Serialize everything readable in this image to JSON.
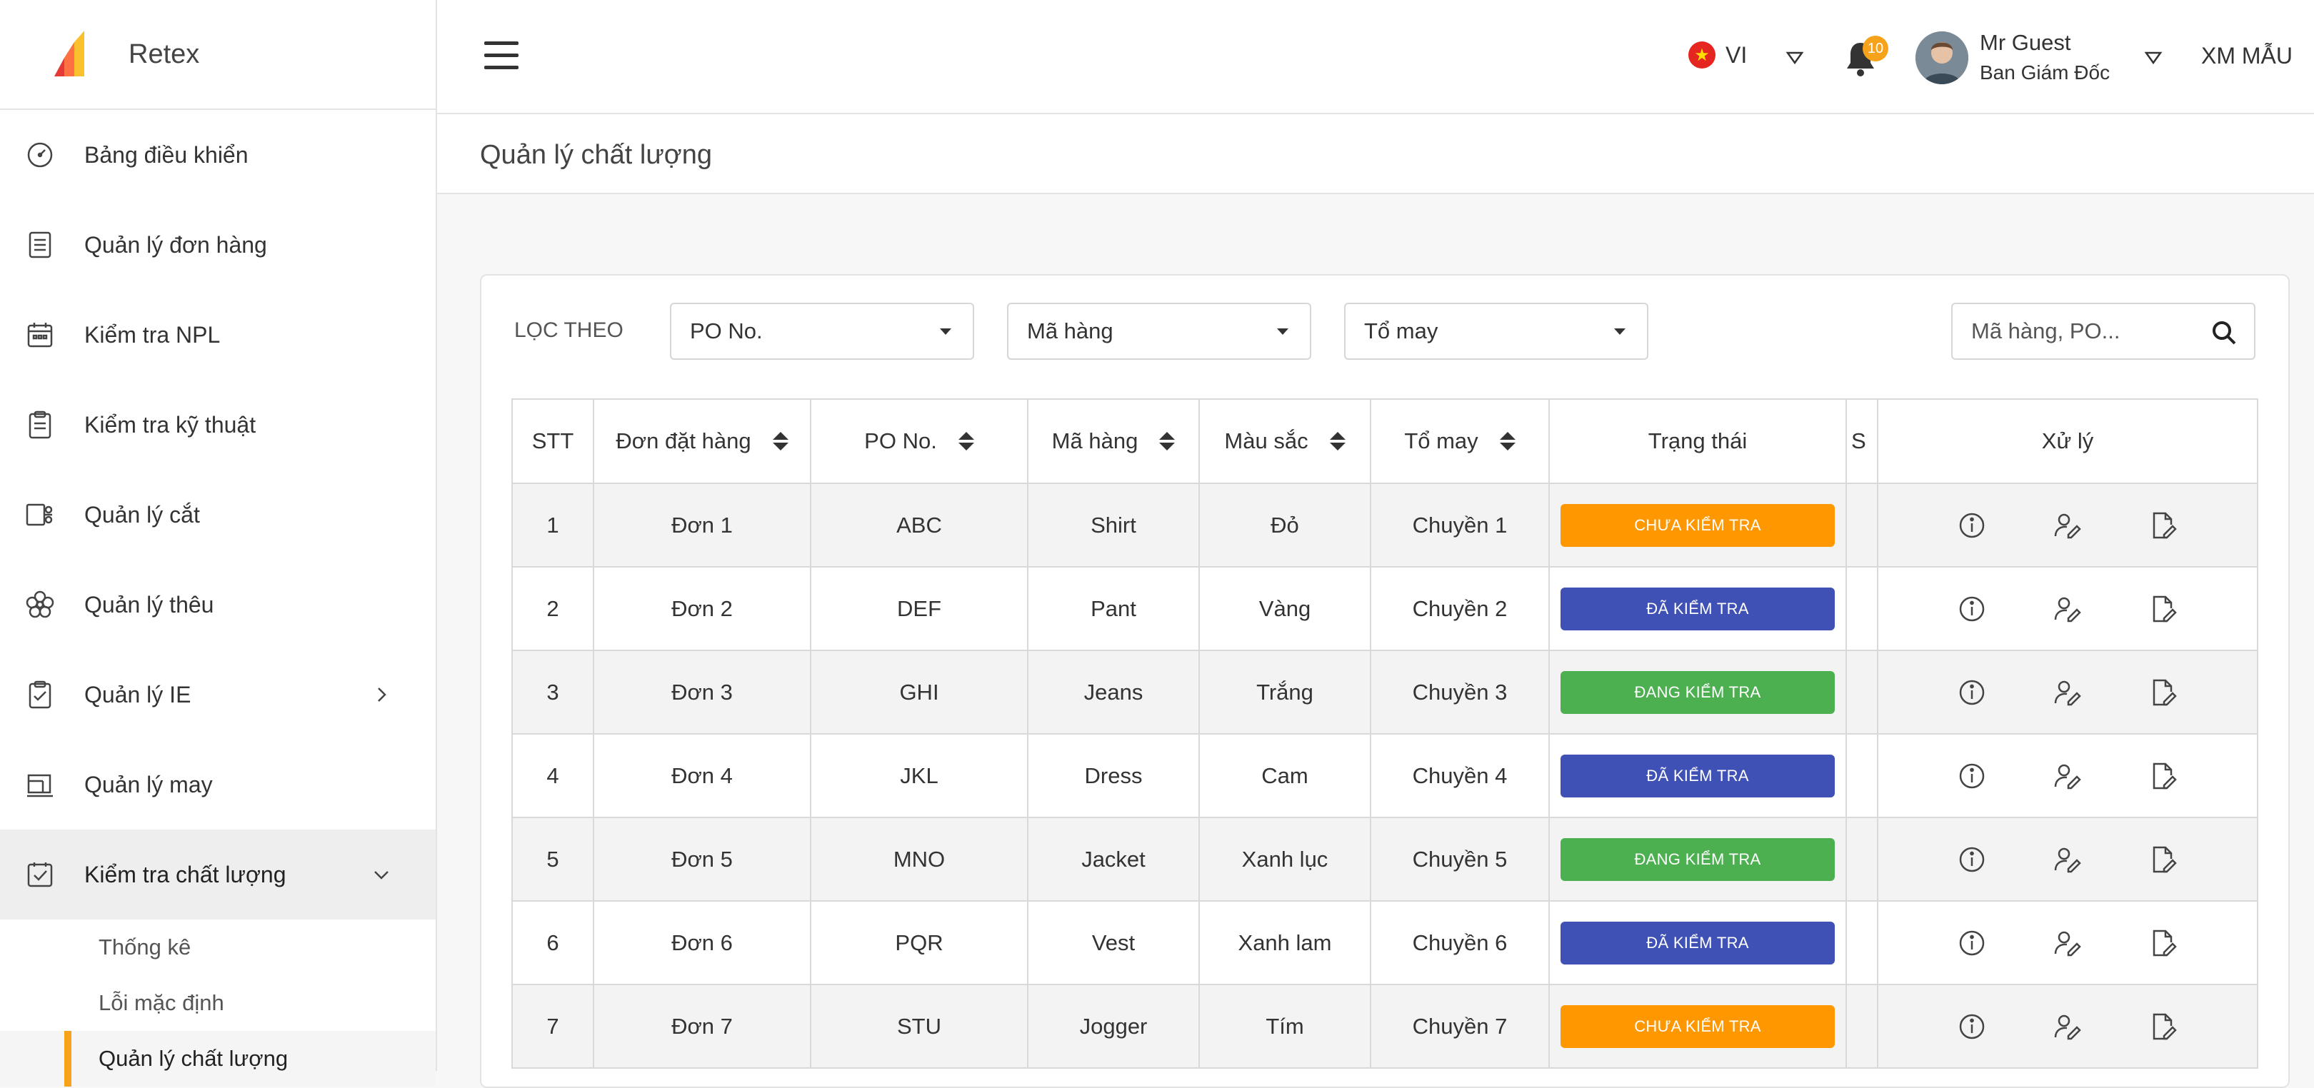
{
  "app": {
    "name": "Retex"
  },
  "sidebar": {
    "items": [
      {
        "label": "Bảng điều khiển",
        "icon": "dashboard-icon"
      },
      {
        "label": "Quản lý đơn hàng",
        "icon": "document-list-icon"
      },
      {
        "label": "Kiểm tra NPL",
        "icon": "calendar-icon"
      },
      {
        "label": "Kiểm tra kỹ thuật",
        "icon": "clipboard-icon"
      },
      {
        "label": "Quản lý cắt",
        "icon": "scissors-icon"
      },
      {
        "label": "Quản lý thêu",
        "icon": "flower-icon"
      },
      {
        "label": "Quản lý IE",
        "icon": "clipboard-check-icon"
      },
      {
        "label": "Quản lý may",
        "icon": "sewing-machine-icon"
      },
      {
        "label": "Kiểm tra chất lượng",
        "icon": "checkbox-icon"
      }
    ],
    "subitems": [
      "Thống kê",
      "Lỗi mặc định",
      "Quản lý chất lượng"
    ]
  },
  "header": {
    "language": "VI",
    "notification_count": "10",
    "user_name": "Mr Guest",
    "user_role": "Ban Giám Đốc",
    "org": "XM MẪU"
  },
  "page": {
    "title": "Quản lý chất lượng"
  },
  "filter": {
    "label": "LỌC THEO",
    "po": "PO No.",
    "product": "Mã hàng",
    "team": "Tổ may",
    "search_placeholder": "Mã hàng, PO..."
  },
  "table": {
    "columns": [
      "STT",
      "Đơn đặt hàng",
      "PO No.",
      "Mã hàng",
      "Màu sắc",
      "Tổ may",
      "Trạng thái",
      "S",
      "Xử lý"
    ],
    "rows": [
      {
        "stt": "1",
        "order": "Đơn 1",
        "po": "ABC",
        "product": "Shirt",
        "color": "Đỏ",
        "team": "Chuyền 1",
        "status": "CHƯA KIỂM TRA",
        "status_color": "#ff9800"
      },
      {
        "stt": "2",
        "order": "Đơn 2",
        "po": "DEF",
        "product": "Pant",
        "color": "Vàng",
        "team": "Chuyền 2",
        "status": "ĐÃ KIỂM TRA",
        "status_color": "#3f51b5"
      },
      {
        "stt": "3",
        "order": "Đơn 3",
        "po": "GHI",
        "product": "Jeans",
        "color": "Trắng",
        "team": "Chuyền 3",
        "status": "ĐANG KIỂM TRA",
        "status_color": "#4caf50"
      },
      {
        "stt": "4",
        "order": "Đơn 4",
        "po": "JKL",
        "product": "Dress",
        "color": "Cam",
        "team": "Chuyền 4",
        "status": "ĐÃ KIỂM TRA",
        "status_color": "#3f51b5"
      },
      {
        "stt": "5",
        "order": "Đơn 5",
        "po": "MNO",
        "product": "Jacket",
        "color": "Xanh lục",
        "team": "Chuyền 5",
        "status": "ĐANG KIỂM TRA",
        "status_color": "#4caf50"
      },
      {
        "stt": "6",
        "order": "Đơn 6",
        "po": "PQR",
        "product": "Vest",
        "color": "Xanh lam",
        "team": "Chuyền 6",
        "status": "ĐÃ KIỂM TRA",
        "status_color": "#3f51b5"
      },
      {
        "stt": "7",
        "order": "Đơn 7",
        "po": "STU",
        "product": "Jogger",
        "color": "Tím",
        "team": "Chuyền 7",
        "status": "CHƯA KIỂM TRA",
        "status_color": "#ff9800"
      }
    ]
  },
  "colors": {
    "accent": "#f7a21b",
    "pending": "#ff9800",
    "done": "#3f51b5",
    "in_progress": "#4caf50"
  }
}
